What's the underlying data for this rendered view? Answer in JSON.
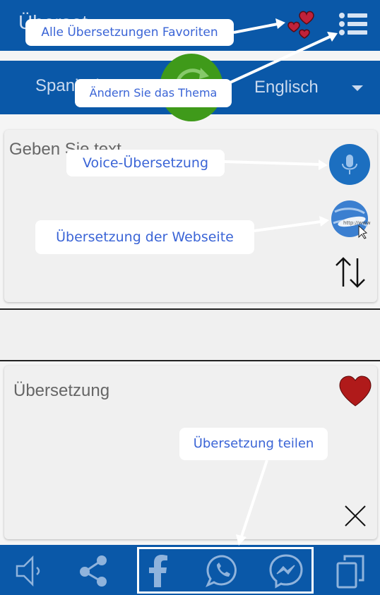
{
  "header": {
    "app_title": "Überset",
    "favorites_icon": "hearts-icon",
    "menu_icon": "list-menu-icon"
  },
  "language_bar": {
    "source_language": "Spanisch",
    "target_language": "Englisch",
    "swap_icon": "refresh-icon"
  },
  "input_card": {
    "placeholder": "Geben Sie text",
    "mic_icon": "microphone-icon",
    "web_icon": "globe-icon",
    "swap_text_icon": "up-down-arrows-icon"
  },
  "output_card": {
    "placeholder": "Übersetzung",
    "favorite_icon": "heart-icon",
    "clear_icon": "close-icon"
  },
  "bottom_bar": {
    "icons": [
      "speaker-icon",
      "share-icon",
      "facebook-icon",
      "whatsapp-icon",
      "messenger-icon",
      "copy-icon"
    ]
  },
  "tooltips": {
    "favorites": "Alle Übersetzungen Favoriten",
    "theme": "Ändern Sie das Thema",
    "voice": "Voice-Übersetzung",
    "website": "Übersetzung der Webseite",
    "share": "Übersetzung teilen"
  },
  "colors": {
    "brand_blue": "#0a58a8",
    "swap_green": "#3f9a1a",
    "tooltip_text": "#3a64d6",
    "heart_red": "#b01a1a"
  }
}
